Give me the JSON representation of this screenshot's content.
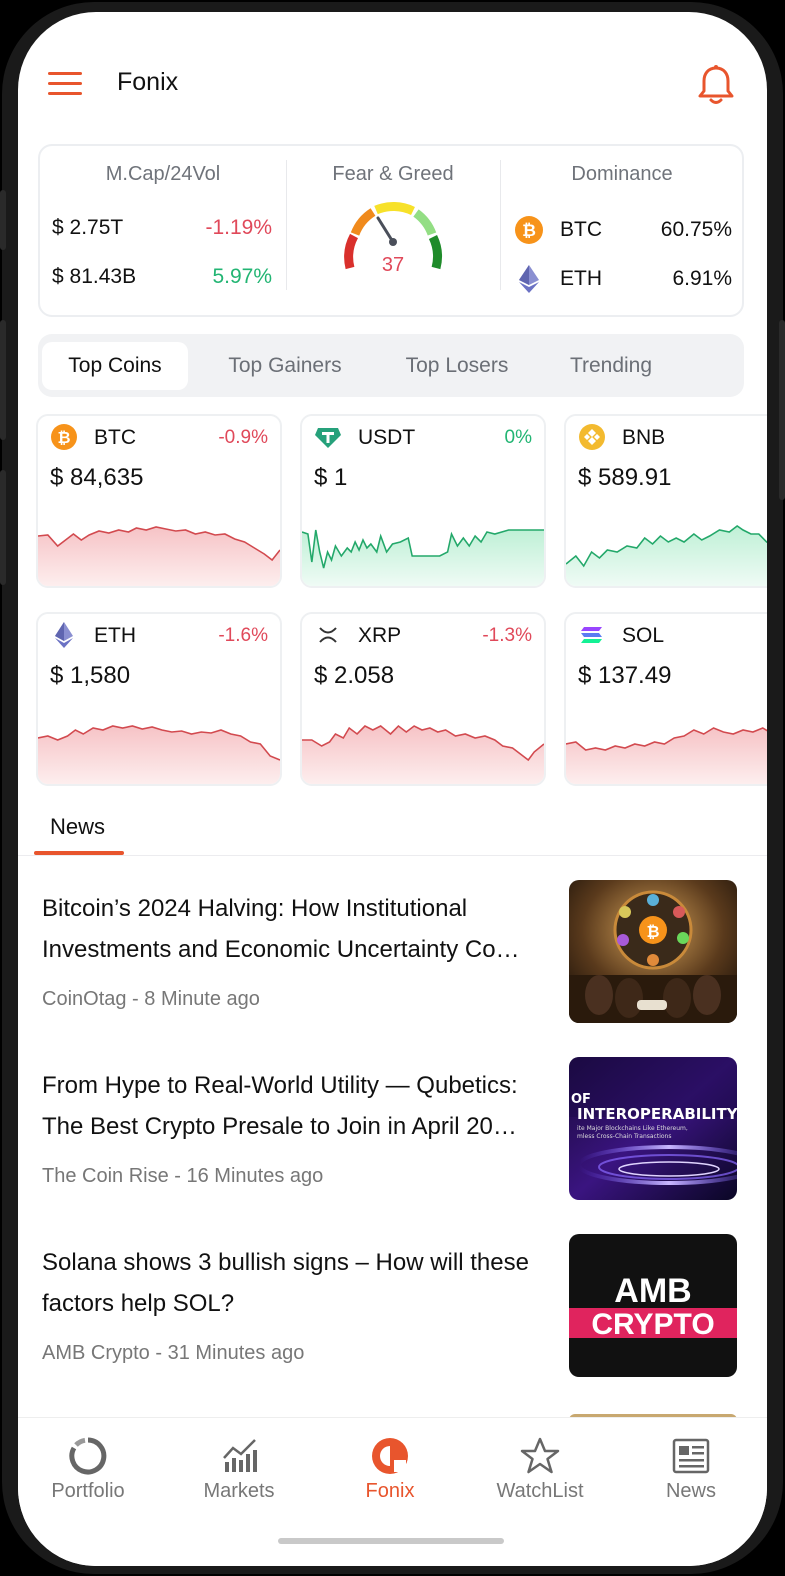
{
  "app": {
    "title": "Fonix"
  },
  "overview": {
    "mcap_header": "M.Cap/24Vol",
    "mcap_value": "$ 2.75T",
    "mcap_change": "-1.19%",
    "vol_value": "$ 81.43B",
    "vol_change": "5.97%",
    "fear_header": "Fear & Greed",
    "fear_value": "37",
    "dominance_header": "Dominance",
    "dominance": [
      {
        "symbol": "BTC",
        "percent": "60.75%",
        "icon": "bitcoin-icon"
      },
      {
        "symbol": "ETH",
        "percent": "6.91%",
        "icon": "ethereum-icon"
      }
    ]
  },
  "tabs": [
    "Top Coins",
    "Top Gainers",
    "Top Losers",
    "Trending"
  ],
  "active_tab": "Top Coins",
  "coins": [
    {
      "symbol": "BTC",
      "price": "$ 84,635",
      "change": "-0.9%",
      "trend": "down",
      "icon": "bitcoin-icon"
    },
    {
      "symbol": "USDT",
      "price": "$ 1",
      "change": "0%",
      "trend": "up",
      "icon": "tether-icon"
    },
    {
      "symbol": "BNB",
      "price": "$ 589.91",
      "change": "",
      "trend": "up",
      "icon": "bnb-icon"
    },
    {
      "symbol": "ETH",
      "price": "$ 1,580",
      "change": "-1.6%",
      "trend": "down",
      "icon": "ethereum-icon"
    },
    {
      "symbol": "XRP",
      "price": "$ 2.058",
      "change": "-1.3%",
      "trend": "down",
      "icon": "xrp-icon"
    },
    {
      "symbol": "SOL",
      "price": "$ 137.49",
      "change": "-",
      "trend": "down",
      "icon": "solana-icon"
    }
  ],
  "news_tab": "News",
  "news": [
    {
      "title": "Bitcoin’s 2024 Halving: How Institutional Investments and Economic Uncertainty Co…",
      "source": "CoinOtag",
      "time": "8 Minute ago",
      "thumb": "bitcoin-halving-thumbnail"
    },
    {
      "title": "From Hype to Real-World Utility — Qubetics: The Best Crypto Presale to Join in April 20…",
      "source": "The Coin Rise",
      "time": "16 Minutes ago",
      "thumb": "interoperability-thumbnail",
      "thumb_text": [
        "OF",
        "INTEROPERABILITY",
        "ite Major Blockchains Like Ethereum,",
        "mless Cross-Chain Transactions"
      ]
    },
    {
      "title": "Solana shows 3 bullish signs – How will these factors help SOL?",
      "source": "AMB Crypto",
      "time": "31 Minutes ago",
      "thumb": "amb-crypto-thumbnail",
      "thumb_text": [
        "AMB",
        "CRYPTO"
      ]
    }
  ],
  "bottom_nav": [
    {
      "label": "Portfolio",
      "icon": "portfolio-icon"
    },
    {
      "label": "Markets",
      "icon": "markets-icon"
    },
    {
      "label": "Fonix",
      "icon": "fonix-icon"
    },
    {
      "label": "WatchList",
      "icon": "star-icon"
    },
    {
      "label": "News",
      "icon": "newspaper-icon"
    }
  ],
  "active_nav": "Fonix",
  "colors": {
    "accent": "#e8552d",
    "negative": "#e0495a",
    "positive": "#22b573"
  }
}
